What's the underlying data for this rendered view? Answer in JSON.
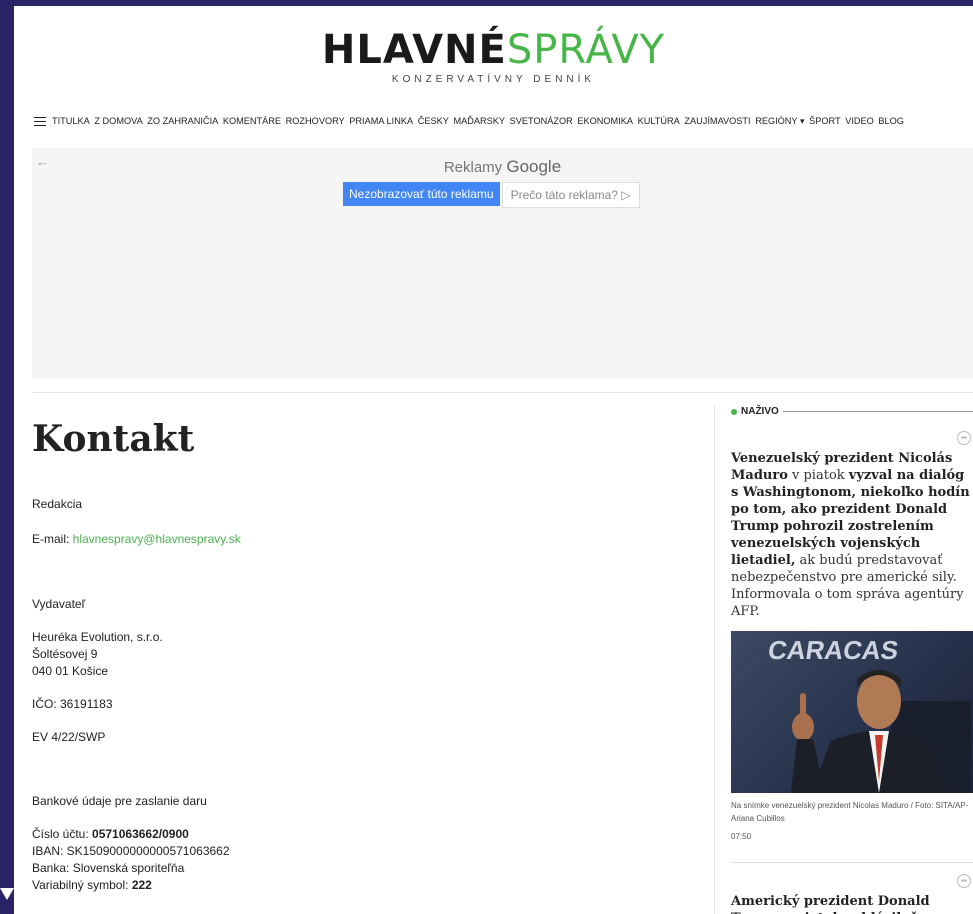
{
  "logo": {
    "part1": "HLAVNÉ",
    "part2": "SPRÁVY",
    "tagline": "KONZERVATÍVNY DENNÍK"
  },
  "nav": {
    "items": [
      "TITULKA",
      "Z DOMOVA",
      "ZO ZAHRANIČIA",
      "KOMENTÁRE",
      "ROZHOVORY",
      "PRIAMA LINKA",
      "ČESKY",
      "MAĎARSKY",
      "SVETONÁZOR",
      "EKONOMIKA",
      "KULTÚRA",
      "ZAUJÍMAVOSTI",
      "REGIÓNY ▾",
      "ŠPORT",
      "VIDEO",
      "BLOG"
    ]
  },
  "ad": {
    "back": "←",
    "title_prefix": "Reklamy",
    "title_brand": "Google",
    "hide_button": "Nezobrazovať túto reklamu",
    "why_button": "Prečo táto reklama? ▷"
  },
  "contact": {
    "title": "Kontakt",
    "redakcia": "Redakcia",
    "email_label": "E-mail: ",
    "email": "hlavnespravy@hlavnespravy.sk",
    "vydavatel": "Vydavateľ",
    "company": "Heuréka Evolution, s.r.o.",
    "street": "Šoltésovej 9",
    "city": "040 01  Košice",
    "ico": "IČO: 36191183",
    "ev": "EV 4/22/SWP",
    "bank_heading": "Bankové údaje pre zaslanie daru",
    "account_label": "Číslo účtu: ",
    "account": "0571063662/0900",
    "iban": "IBAN: SK1509000000000571063662",
    "bank": "Banka: Slovenská sporiteľňa",
    "vs_label": "Variabilný symbol: ",
    "vs": "222"
  },
  "live": {
    "label": "NAŽIVO",
    "news1": {
      "b1": "Venezuelský prezident Nicolás Maduro",
      "t1": " v piatok ",
      "b2": "vyzval na dialóg s Washingtonom, niekoľko hodín po tom, ako prezident Donald Trump pohrozil zostrelením venezuelských vojenských lietadiel,",
      "t2": " ak budú predstavovať nebezpečenstvo pre americké sily. Informovala o tom správa agentúry AFP.",
      "caption": "Na snímke venezuelský prezident Nicolas Maduro / Foto: SITA/AP-Ariana Cubillos",
      "time": "07:50"
    },
    "news2": {
      "b1": "Americký prezident Donald Trump v piatok vyhlásil, že"
    }
  },
  "colors": {
    "brand_green": "#47b649",
    "frame": "#2a2368",
    "ad_button": "#4285f4"
  }
}
